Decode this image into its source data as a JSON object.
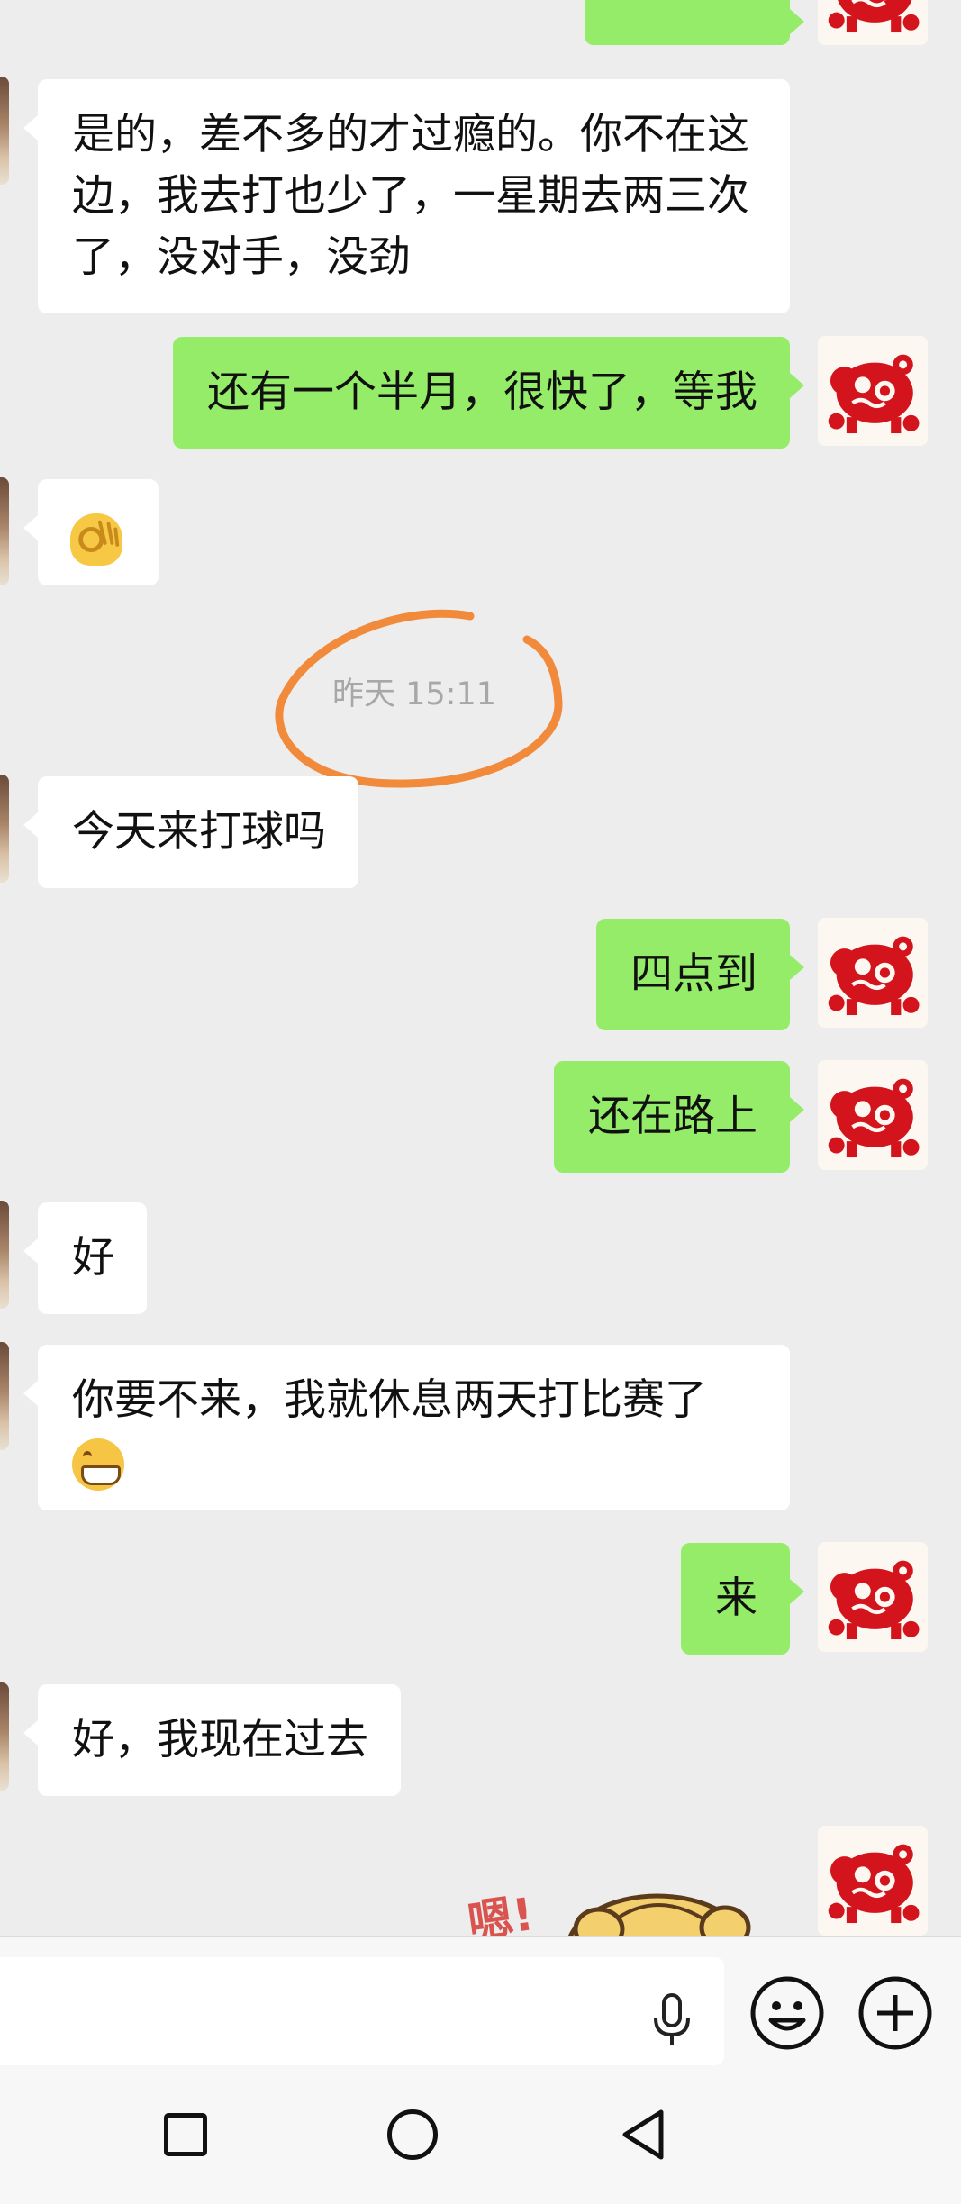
{
  "conversation": {
    "messages": [
      {
        "direction": "out",
        "text": ""
      },
      {
        "direction": "in",
        "text": "是的，差不多的才过瘾的。你不在这边，我去打也少了，一星期去两三次了，没对手，没劲"
      },
      {
        "direction": "out",
        "text": "还有一个半月，很快了，等我"
      },
      {
        "direction": "in",
        "emoji": "ok-hand-emoji"
      },
      {
        "timestamp": "昨天 15:11"
      },
      {
        "direction": "in",
        "text": "今天来打球吗"
      },
      {
        "direction": "out",
        "text": "四点到"
      },
      {
        "direction": "out",
        "text": "还在路上"
      },
      {
        "direction": "in",
        "text": "好"
      },
      {
        "direction": "in",
        "text": "你要不来，我就休息两天打比赛了",
        "emoji": "grin-emoji"
      },
      {
        "direction": "out",
        "text": "来"
      },
      {
        "direction": "in",
        "text": "好，我现在过去"
      },
      {
        "direction": "out",
        "sticker": "cartoon-sticker",
        "sticker_text": "嗯!"
      }
    ]
  },
  "input": {
    "value": "",
    "placeholder": ""
  },
  "icons": {
    "voice": "microphone-icon",
    "emoji": "smiley-icon",
    "more": "plus-icon",
    "nav_recent": "square-icon",
    "nav_home": "circle-icon",
    "nav_back": "triangle-back-icon"
  },
  "colors": {
    "background": "#ededed",
    "incoming_bubble": "#ffffff",
    "outgoing_bubble": "#95ec69",
    "timestamp_text": "#a7a7a7",
    "annotation_circle": "#f28a3c",
    "avatar_papercut": "#d4141c"
  }
}
